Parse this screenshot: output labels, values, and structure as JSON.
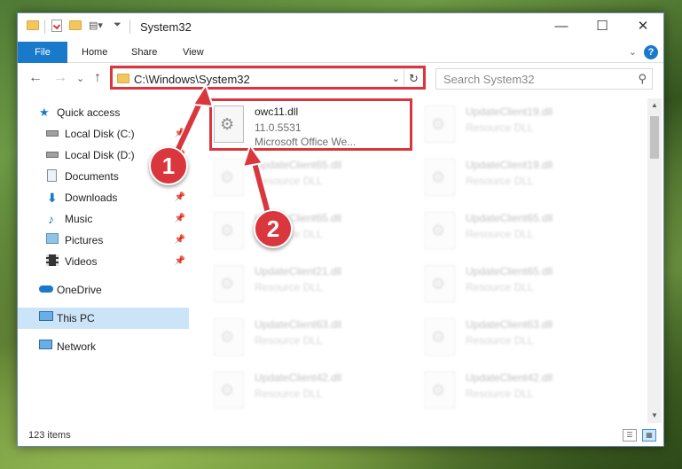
{
  "window": {
    "title": "System32",
    "controls": {
      "minimize": "—",
      "maximize": "☐",
      "close": "✕"
    }
  },
  "ribbon": {
    "tabs": [
      "File",
      "Home",
      "Share",
      "View"
    ],
    "help": "?",
    "expand": "⌄"
  },
  "nav": {
    "back": "←",
    "forward": "→",
    "recent": "⌄",
    "up": "↑",
    "address": "C:\\Windows\\System32",
    "address_dropdown": "⌄",
    "refresh": "↻",
    "search_placeholder": "Search System32",
    "search_icon": "⚲"
  },
  "sidebar": {
    "items": [
      {
        "label": "Quick access",
        "icon": "star-icon",
        "pinned": false
      },
      {
        "label": "Local Disk (C:)",
        "icon": "drive-icon",
        "pinned": true
      },
      {
        "label": "Local Disk (D:)",
        "icon": "drive-icon",
        "pinned": true
      },
      {
        "label": "Documents",
        "icon": "documents-icon",
        "pinned": true
      },
      {
        "label": "Downloads",
        "icon": "download-icon",
        "pinned": true
      },
      {
        "label": "Music",
        "icon": "music-icon",
        "pinned": true
      },
      {
        "label": "Pictures",
        "icon": "pictures-icon",
        "pinned": true
      },
      {
        "label": "Videos",
        "icon": "videos-icon",
        "pinned": true
      },
      {
        "label": "OneDrive",
        "icon": "cloud-icon",
        "pinned": false
      },
      {
        "label": "This PC",
        "icon": "computer-icon",
        "pinned": false,
        "selected": true
      },
      {
        "label": "Network",
        "icon": "network-icon",
        "pinned": false
      }
    ],
    "pin_glyph": "📌"
  },
  "files": {
    "highlighted": {
      "name": "owc11.dll",
      "version": "11.0.5531",
      "description": "Microsoft Office We..."
    },
    "column1": [
      {
        "name": "UpdateClient65.dll",
        "type": "Resource DLL"
      },
      {
        "name": "UpdateClient65.dll",
        "type": "Resource DLL"
      },
      {
        "name": "UpdateClient21.dll",
        "type": "Resource DLL"
      },
      {
        "name": "UpdateClient63.dll",
        "type": "Resource DLL"
      },
      {
        "name": "UpdateClient42.dll",
        "type": "Resource DLL"
      }
    ],
    "column2": [
      {
        "name": "UpdateClient19.dll",
        "type": "Resource DLL"
      },
      {
        "name": "UpdateClient19.dll",
        "type": "Resource DLL"
      },
      {
        "name": "UpdateClient65.dll",
        "type": "Resource DLL"
      },
      {
        "name": "UpdateClient65.dll",
        "type": "Resource DLL"
      },
      {
        "name": "UpdateClient63.dll",
        "type": "Resource DLL"
      },
      {
        "name": "UpdateClient42.dll",
        "type": "Resource DLL"
      }
    ]
  },
  "status": {
    "count": "123 items"
  },
  "callouts": {
    "one": "1",
    "two": "2"
  },
  "colors": {
    "accent": "#1979ca",
    "highlight": "#d9363e",
    "selected": "#cce4f7"
  }
}
